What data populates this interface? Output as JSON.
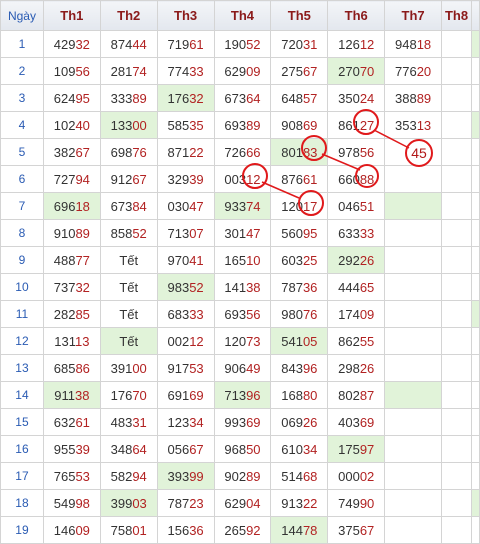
{
  "header": {
    "day": "Ngày",
    "cols": [
      "Th1",
      "Th2",
      "Th3",
      "Th4",
      "Th5",
      "Th6",
      "Th7",
      "Th8"
    ]
  },
  "rows": [
    {
      "day": "1",
      "cells": [
        "42932",
        "87444",
        "71961",
        "19052",
        "72031",
        "12612",
        "94818",
        ""
      ]
    },
    {
      "day": "2",
      "cells": [
        "10956",
        "28174",
        "77433",
        "62909",
        "27567",
        "27070",
        "77620",
        ""
      ]
    },
    {
      "day": "3",
      "cells": [
        "62495",
        "33389",
        "17632",
        "67364",
        "64857",
        "35024",
        "38889",
        ""
      ]
    },
    {
      "day": "4",
      "cells": [
        "10240",
        "13300",
        "58535",
        "69389",
        "90869",
        "86127",
        "35313",
        ""
      ]
    },
    {
      "day": "5",
      "cells": [
        "38267",
        "69876",
        "87122",
        "72666",
        "80183",
        "97856",
        "",
        ""
      ]
    },
    {
      "day": "6",
      "cells": [
        "72794",
        "91267",
        "32939",
        "00312",
        "87661",
        "66088",
        "",
        ""
      ]
    },
    {
      "day": "7",
      "cells": [
        "69618",
        "67384",
        "03047",
        "93374",
        "12017",
        "04651",
        "",
        ""
      ]
    },
    {
      "day": "8",
      "cells": [
        "91089",
        "85852",
        "71307",
        "30147",
        "56095",
        "63333",
        "",
        ""
      ]
    },
    {
      "day": "9",
      "cells": [
        "48877",
        "Tết",
        "97041",
        "16510",
        "60325",
        "29226",
        "",
        ""
      ]
    },
    {
      "day": "10",
      "cells": [
        "73732",
        "Tết",
        "98352",
        "14138",
        "78736",
        "44465",
        "",
        ""
      ]
    },
    {
      "day": "11",
      "cells": [
        "28285",
        "Tết",
        "68333",
        "69356",
        "98076",
        "17409",
        "",
        ""
      ]
    },
    {
      "day": "12",
      "cells": [
        "13113",
        "Tết",
        "00212",
        "12073",
        "54105",
        "86255",
        "",
        ""
      ]
    },
    {
      "day": "13",
      "cells": [
        "68586",
        "39100",
        "91753",
        "90649",
        "84396",
        "29826",
        "",
        ""
      ]
    },
    {
      "day": "14",
      "cells": [
        "91138",
        "17670",
        "69169",
        "71396",
        "16880",
        "80287",
        "",
        ""
      ]
    },
    {
      "day": "15",
      "cells": [
        "63261",
        "48331",
        "12334",
        "99369",
        "06926",
        "40369",
        "",
        ""
      ]
    },
    {
      "day": "16",
      "cells": [
        "95539",
        "34864",
        "05667",
        "96850",
        "61034",
        "17597",
        "",
        ""
      ]
    },
    {
      "day": "17",
      "cells": [
        "76553",
        "58294",
        "39399",
        "90289",
        "51468",
        "00002",
        "",
        ""
      ]
    },
    {
      "day": "18",
      "cells": [
        "54998",
        "39903",
        "78723",
        "62904",
        "91322",
        "74990",
        "",
        ""
      ]
    },
    {
      "day": "19",
      "cells": [
        "14609",
        "75801",
        "15636",
        "26592",
        "14478",
        "37567",
        "",
        ""
      ]
    }
  ],
  "annotation": {
    "sum_label": "45"
  },
  "colors": {
    "highlight": "#e1f3d9",
    "digits": "#333333",
    "tail_digits": "#b22222",
    "day_numbers": "#2a5bb3",
    "header_text": "#8b1a1a",
    "annotation_red": "#e0191b"
  }
}
